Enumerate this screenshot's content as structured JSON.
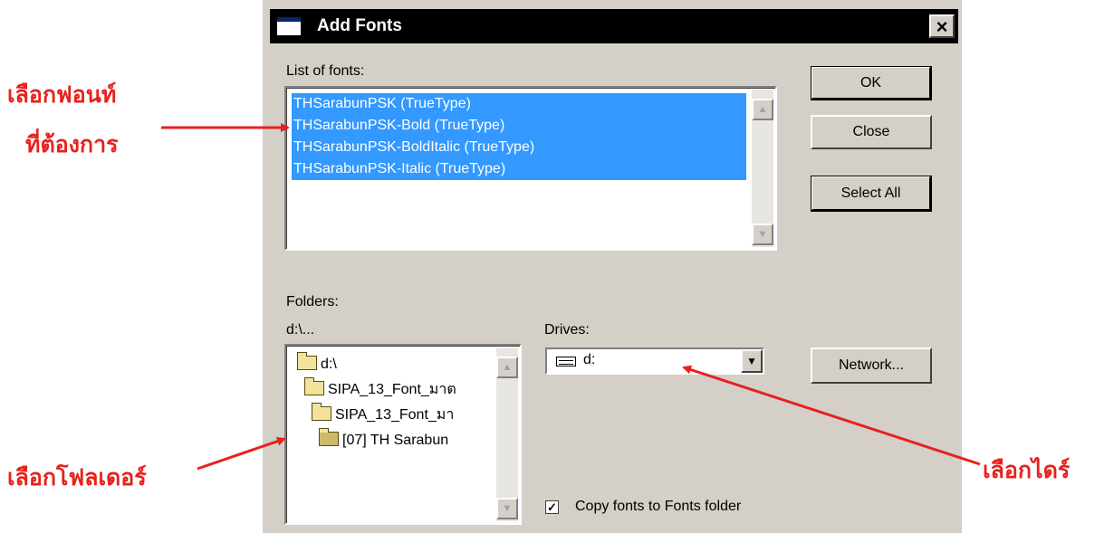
{
  "dialog": {
    "title": "Add Fonts",
    "close_label": "×",
    "list_label": "List of fonts:",
    "fonts": [
      "THSarabunPSK (TrueType)",
      "THSarabunPSK-Bold (TrueType)",
      "THSarabunPSK-BoldItalic (TrueType)",
      "THSarabunPSK-Italic (TrueType)"
    ],
    "buttons": {
      "ok": "OK",
      "close": "Close",
      "select_all": "Select All",
      "network": "Network..."
    },
    "folders_label": "Folders:",
    "current_path": "d:\\...",
    "folders": [
      "d:\\",
      "SIPA_13_Font_มาต",
      "SIPA_13_Font_มา",
      "[07] TH Sarabun"
    ],
    "drives_label": "Drives:",
    "drive_value": "d:",
    "copy_fonts": {
      "label": "Copy fonts to Fonts folder",
      "checked": true,
      "mark": "✓"
    },
    "scroll_up": "▲",
    "scroll_down": "▼",
    "dropdown_arrow": "▼"
  },
  "annotations": {
    "select_font_line1": "เลือกฟอนท์",
    "select_font_line2": "ที่ต้องการ",
    "select_folder": "เลือกโฟลเดอร์",
    "select_drive": "เลือกไดร์"
  },
  "colors": {
    "selection": "#3399ff",
    "annotation": "#e8211d",
    "dialog_face": "#d4d0c8"
  },
  "icons": [
    "app-window-icon",
    "close-icon",
    "folder-open-icon",
    "drive-icon",
    "arrow-annotation"
  ]
}
